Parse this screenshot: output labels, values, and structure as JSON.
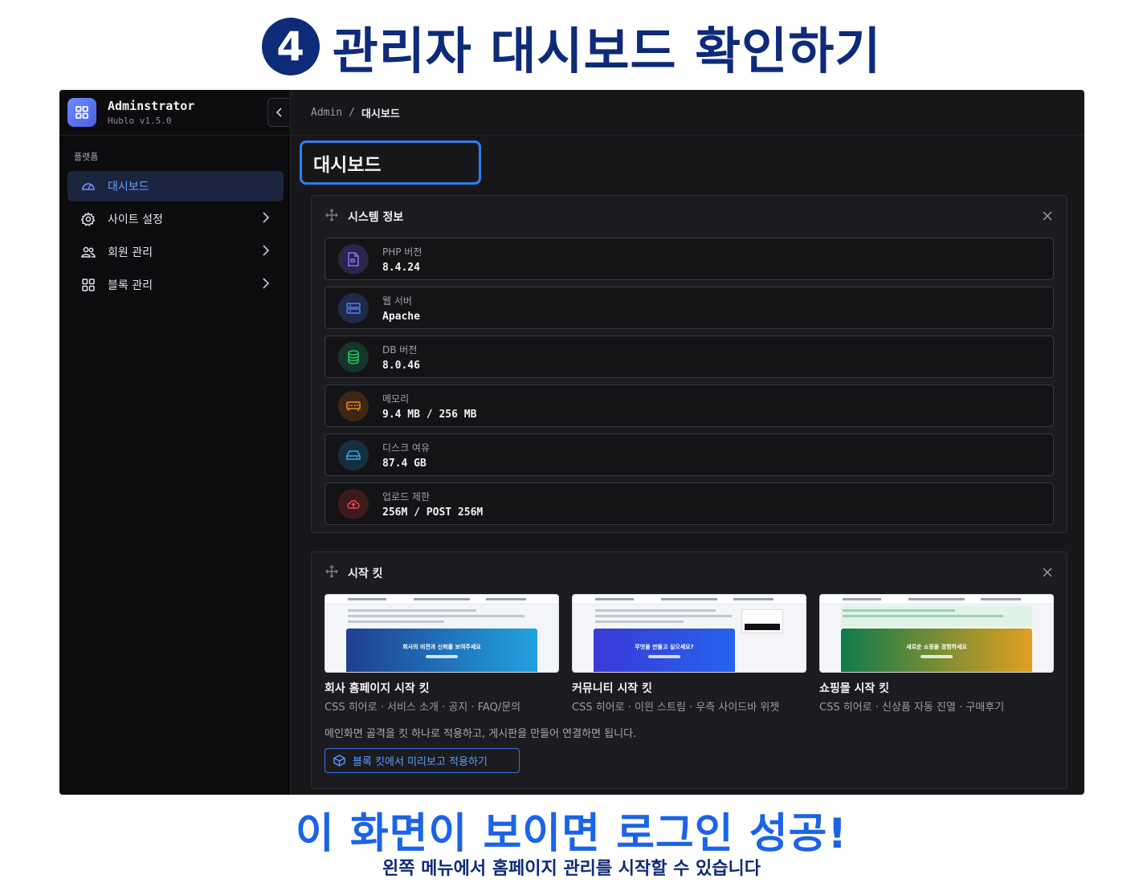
{
  "heading": {
    "step": "4",
    "title": "관리자 대시보드 확인하기"
  },
  "sidebar": {
    "brand_name": "Adminstrator",
    "brand_version": "Hublo v1.5.0",
    "collapse_icon": "chevron-left-icon",
    "section_label": "플랫폼",
    "items": [
      {
        "label": "대시보드",
        "icon": "gauge-icon",
        "active": true
      },
      {
        "label": "사이트 설정",
        "icon": "gear-icon"
      },
      {
        "label": "회원 관리",
        "icon": "users-icon"
      },
      {
        "label": "블록 관리",
        "icon": "grid-icon"
      }
    ]
  },
  "breadcrumb": {
    "root": "Admin",
    "separator": "/",
    "current": "대시보드"
  },
  "page_title": "대시보드",
  "system_panel": {
    "title": "시스템 정보",
    "rows": [
      {
        "label": "PHP 버전",
        "value": "8.4.24",
        "icon": "php-file-icon",
        "color": "#8b6cff"
      },
      {
        "label": "웹 서버",
        "value": "Apache",
        "icon": "server-icon",
        "color": "#4d7cff"
      },
      {
        "label": "DB 버전",
        "value": "8.0.46",
        "icon": "database-icon",
        "color": "#22c55e"
      },
      {
        "label": "메모리",
        "value": "9.4 MB / 256 MB",
        "icon": "memory-icon",
        "color": "#f08a2a"
      },
      {
        "label": "디스크 여유",
        "value": "87.4 GB",
        "icon": "hard-drive-icon",
        "color": "#38a6e8"
      },
      {
        "label": "업로드 제한",
        "value": "256M / POST 256M",
        "icon": "cloud-upload-icon",
        "color": "#e84a4a"
      }
    ]
  },
  "kits_panel": {
    "title": "시작 킷",
    "kits": [
      {
        "name": "회사 홈페이지 시작 킷",
        "desc": "CSS 히어로 · 서비스 소개 · 공지 · FAQ/문의",
        "hero_text": "회사의 비전과 신뢰를 보여주세요",
        "hero_from": "#1f3f8f",
        "hero_to": "#22a2e0"
      },
      {
        "name": "커뮤니티 시작 킷",
        "desc": "CSS 히어로 · 이읜 스트림 · 우측 사이드바 위젯",
        "hero_text": "무엇을 만들고 싶으세요?",
        "hero_from": "#3a3ad6",
        "hero_to": "#2563eb"
      },
      {
        "name": "쇼핑몰 시작 킷",
        "desc": "CSS 히어로 · 신상품 자동 진열 · 구매후기",
        "hero_text": "새로운 쇼핑을 경험하세요",
        "hero_from": "#0f7a4a",
        "hero_to": "#e0a020"
      }
    ],
    "note": "메인화면 골격을 킷 하나로 적용하고, 게시판을 만들어 연결하면 됩니다.",
    "button": "블록 킷에서 미리보고 적용하기"
  },
  "caption": {
    "main": "이 화면이 보이면 로그인 성공!",
    "sub": "왼쪽 메뉴에서 홈페이지 관리를 시작할 수 있습니다"
  }
}
